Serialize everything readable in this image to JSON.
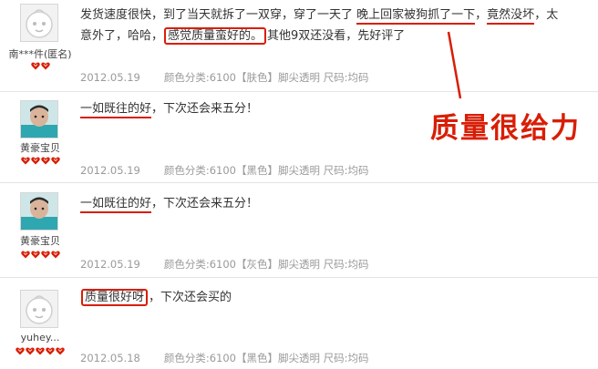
{
  "reviews": [
    {
      "username": "南***件(匿名)",
      "avatar": "default-avatar-icon",
      "rank_icons": 2,
      "text_parts": [
        "发货速度很快，到了当天就拆了一双穿，穿了一天了 ",
        "晚上回家被狗抓了一下",
        "，",
        "竟然没坏",
        "，太",
        "意外了，哈哈，",
        "感觉质量蛮好的。",
        "其他9双还没看，先好评了"
      ],
      "date": "2012.05.19",
      "sku": "颜色分类:6100【肤色】脚尖透明  尺码:均码"
    },
    {
      "username": "黄豪宝贝",
      "avatar": "child-photo-avatar",
      "rank_icons": 4,
      "text_parts": [
        "一如既往的好",
        "，下次还会来五分！"
      ],
      "date": "2012.05.19",
      "sku": "颜色分类:6100【黑色】脚尖透明  尺码:均码"
    },
    {
      "username": "黄豪宝贝",
      "avatar": "child-photo-avatar",
      "rank_icons": 4,
      "text_parts": [
        "一如既往的好",
        "，下次还会来五分！"
      ],
      "date": "2012.05.19",
      "sku": "颜色分类:6100【灰色】脚尖透明  尺码:均码"
    },
    {
      "username": "yuhey...",
      "avatar": "default-avatar-icon",
      "rank_icons": 5,
      "text_parts": [
        "质量很好呀",
        "，下次还会买的"
      ],
      "date": "2012.05.18",
      "sku": "颜色分类:6100【黑色】脚尖透明  尺码:均码"
    }
  ],
  "callout": "质量很给力",
  "colors": {
    "highlight": "#d81e06",
    "meta_text": "#9a9a9a",
    "divider": "#e4e4e4"
  },
  "icons": [
    "default-avatar-icon",
    "child-photo-avatar",
    "red-heart-rank-icon"
  ]
}
